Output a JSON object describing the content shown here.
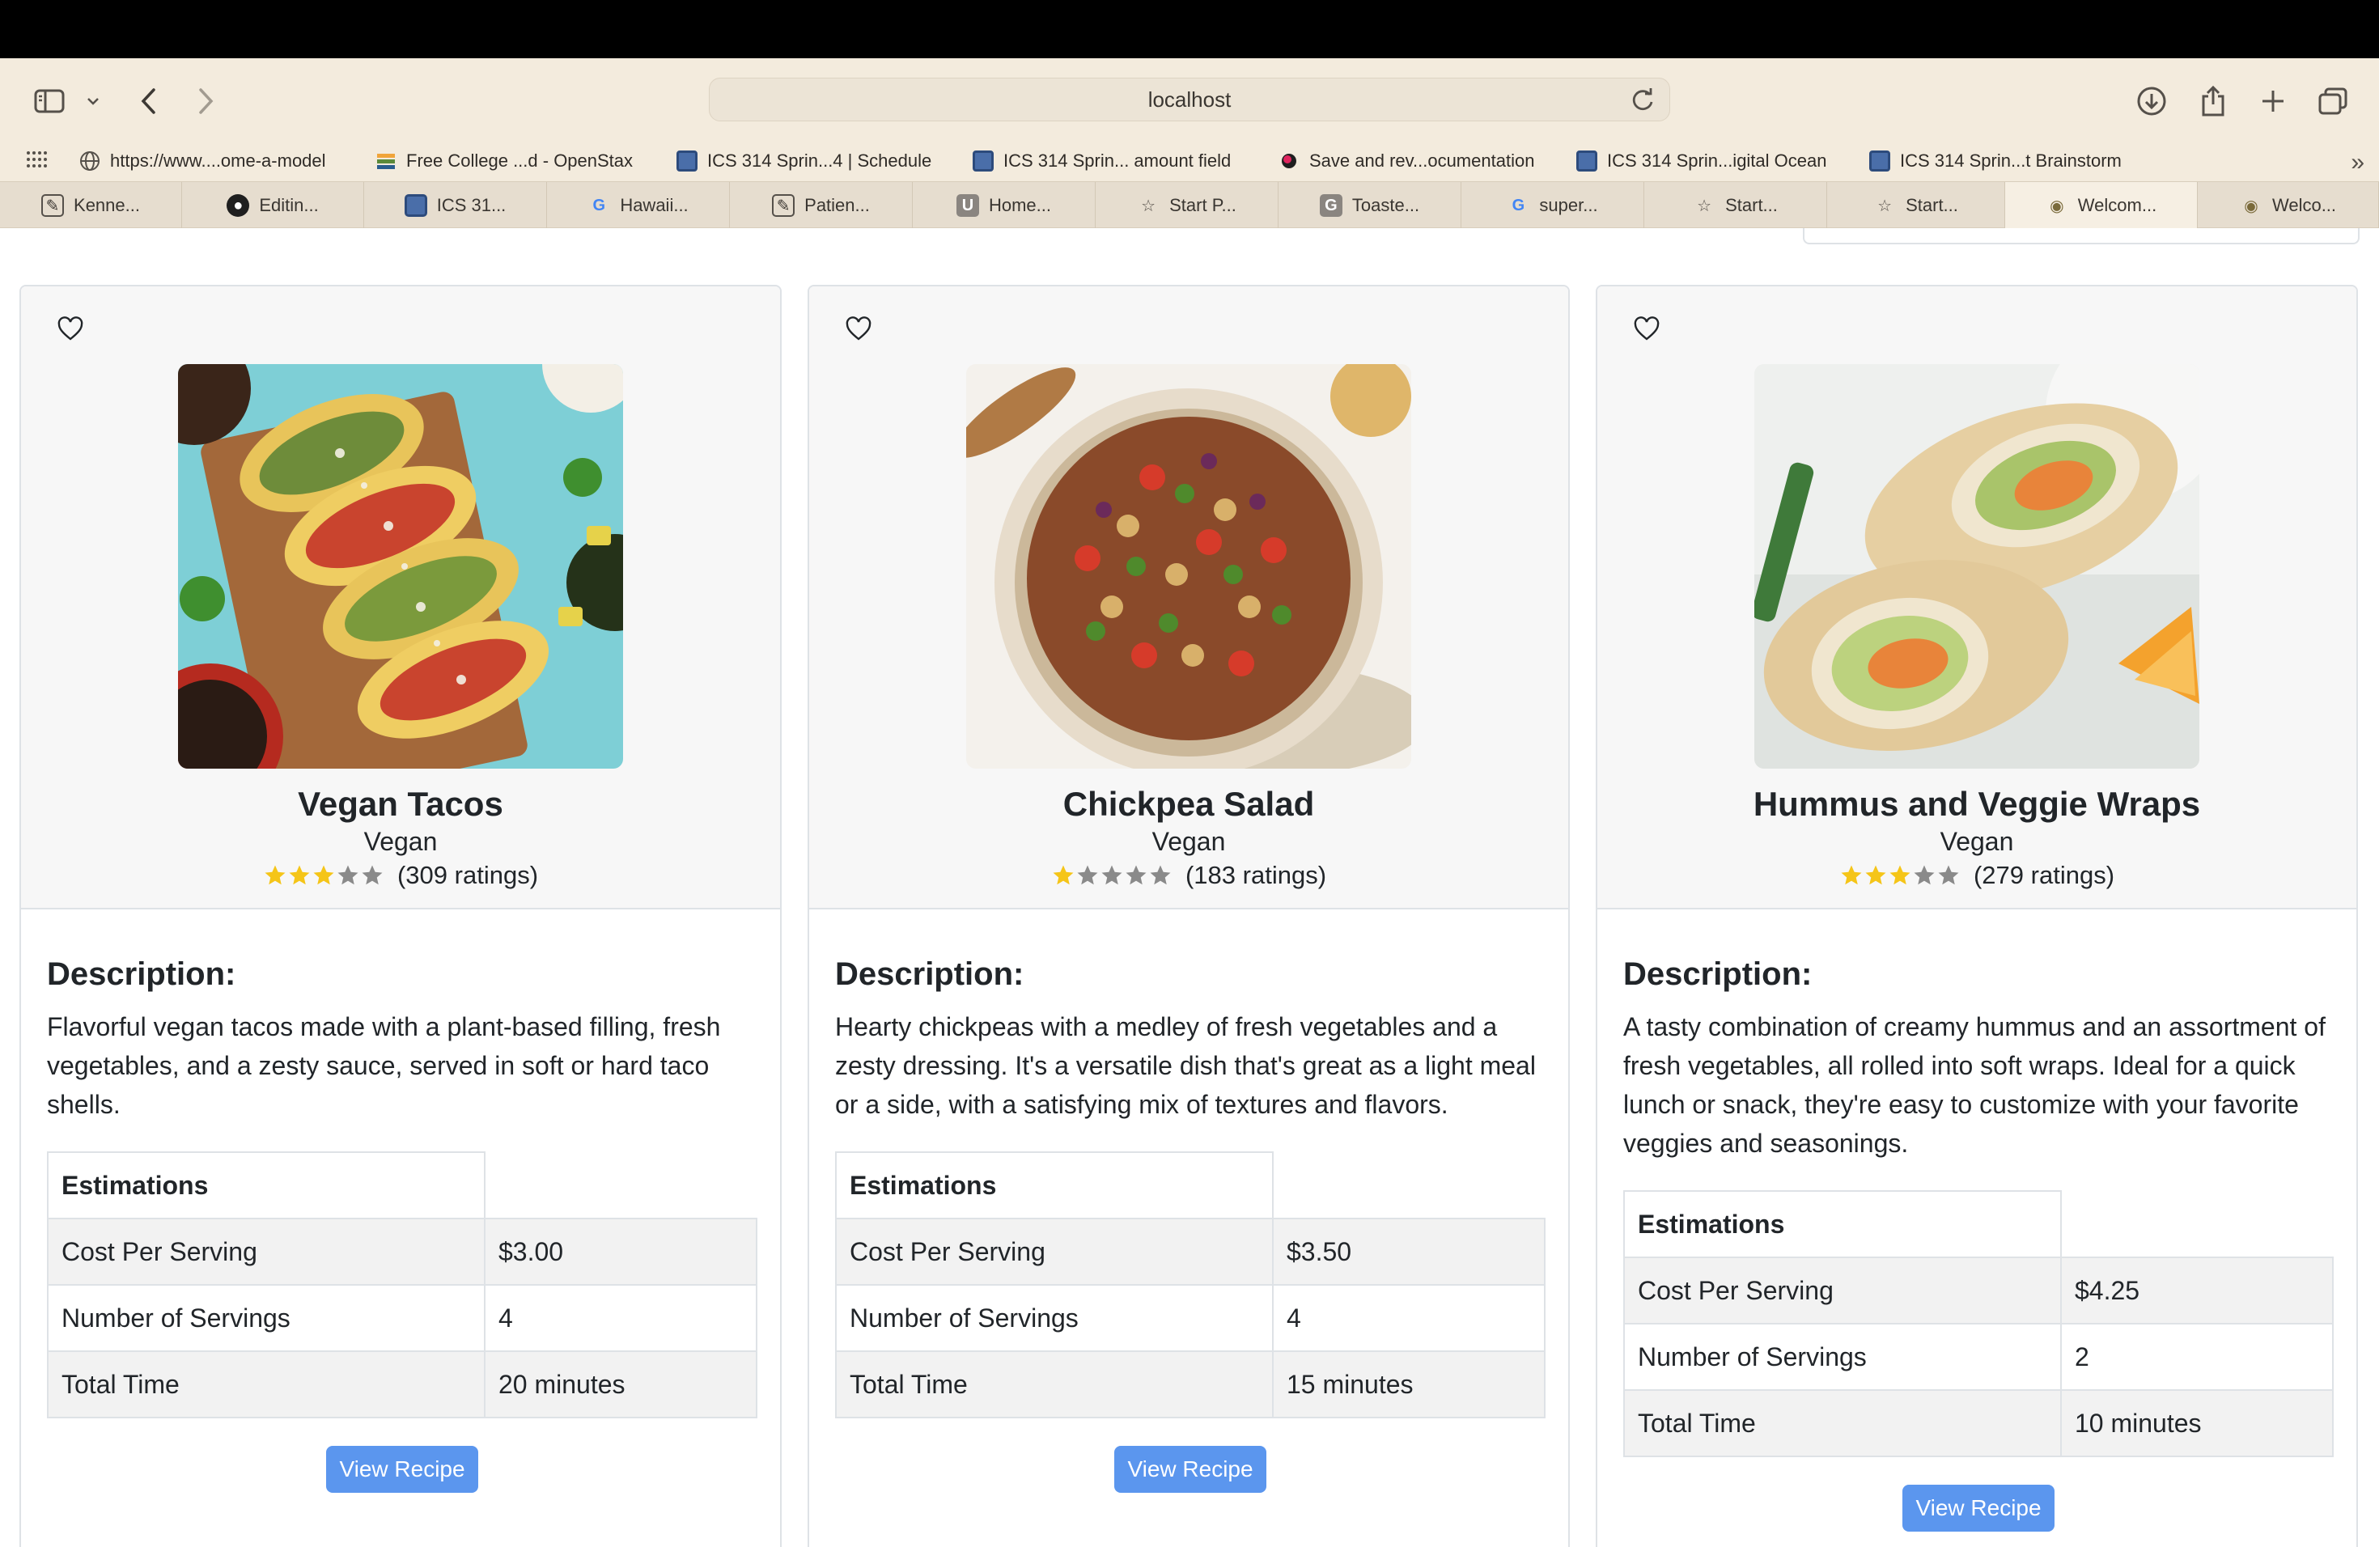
{
  "browser": {
    "address": "localhost",
    "bookmarks": [
      "https://www....ome-a-model",
      "Free College ...d - OpenStax",
      "ICS 314 Sprin...4 | Schedule",
      "ICS 314 Sprin... amount field",
      "Save and rev...ocumentation",
      "ICS 314 Sprin...igital Ocean",
      "ICS 314 Sprin...t Brainstorm"
    ],
    "tabs": [
      "Kenne...",
      "Editin...",
      "ICS 31...",
      "Hawaii...",
      "Patien...",
      "Home...",
      "Start P...",
      "Toaste...",
      "super...",
      "Start...",
      "Start...",
      "Welcom...",
      "Welco..."
    ],
    "active_tab_index": 11
  },
  "recipes": [
    {
      "title": "Vegan Tacos",
      "category": "Vegan",
      "stars": 3,
      "ratings_text": "(309 ratings)",
      "description_heading": "Description:",
      "description": "Flavorful vegan tacos made with a plant-based filling, fresh vegetables, and a zesty sauce, served in soft or hard taco shells.",
      "table": {
        "header": "Estimations",
        "rows": [
          {
            "label": "Cost Per Serving",
            "value": "$3.00"
          },
          {
            "label": "Number of Servings",
            "value": "4"
          },
          {
            "label": "Total Time",
            "value": "20 minutes"
          }
        ]
      },
      "button": "View Recipe"
    },
    {
      "title": "Chickpea Salad",
      "category": "Vegan",
      "stars": 1,
      "ratings_text": "(183 ratings)",
      "description_heading": "Description:",
      "description": "Hearty chickpeas with a medley of fresh vegetables and a zesty dressing. It's a versatile dish that's great as a light meal or a side, with a satisfying mix of textures and flavors.",
      "table": {
        "header": "Estimations",
        "rows": [
          {
            "label": "Cost Per Serving",
            "value": "$3.50"
          },
          {
            "label": "Number of Servings",
            "value": "4"
          },
          {
            "label": "Total Time",
            "value": "15 minutes"
          }
        ]
      },
      "button": "View Recipe"
    },
    {
      "title": "Hummus and Veggie Wraps",
      "category": "Vegan",
      "stars": 3,
      "ratings_text": "(279 ratings)",
      "description_heading": "Description:",
      "description": "A tasty combination of creamy hummus and an assortment of fresh vegetables, all rolled into soft wraps. Ideal for a quick lunch or snack, they're easy to customize with your favorite veggies and seasonings.",
      "table": {
        "header": "Estimations",
        "rows": [
          {
            "label": "Cost Per Serving",
            "value": "$4.25"
          },
          {
            "label": "Number of Servings",
            "value": "2"
          },
          {
            "label": "Total Time",
            "value": "10 minutes"
          }
        ]
      },
      "button": "View Recipe"
    }
  ],
  "colors": {
    "star_filled": "#f5c518",
    "star_empty": "#8a8a8a",
    "button": "#5b96ee"
  }
}
